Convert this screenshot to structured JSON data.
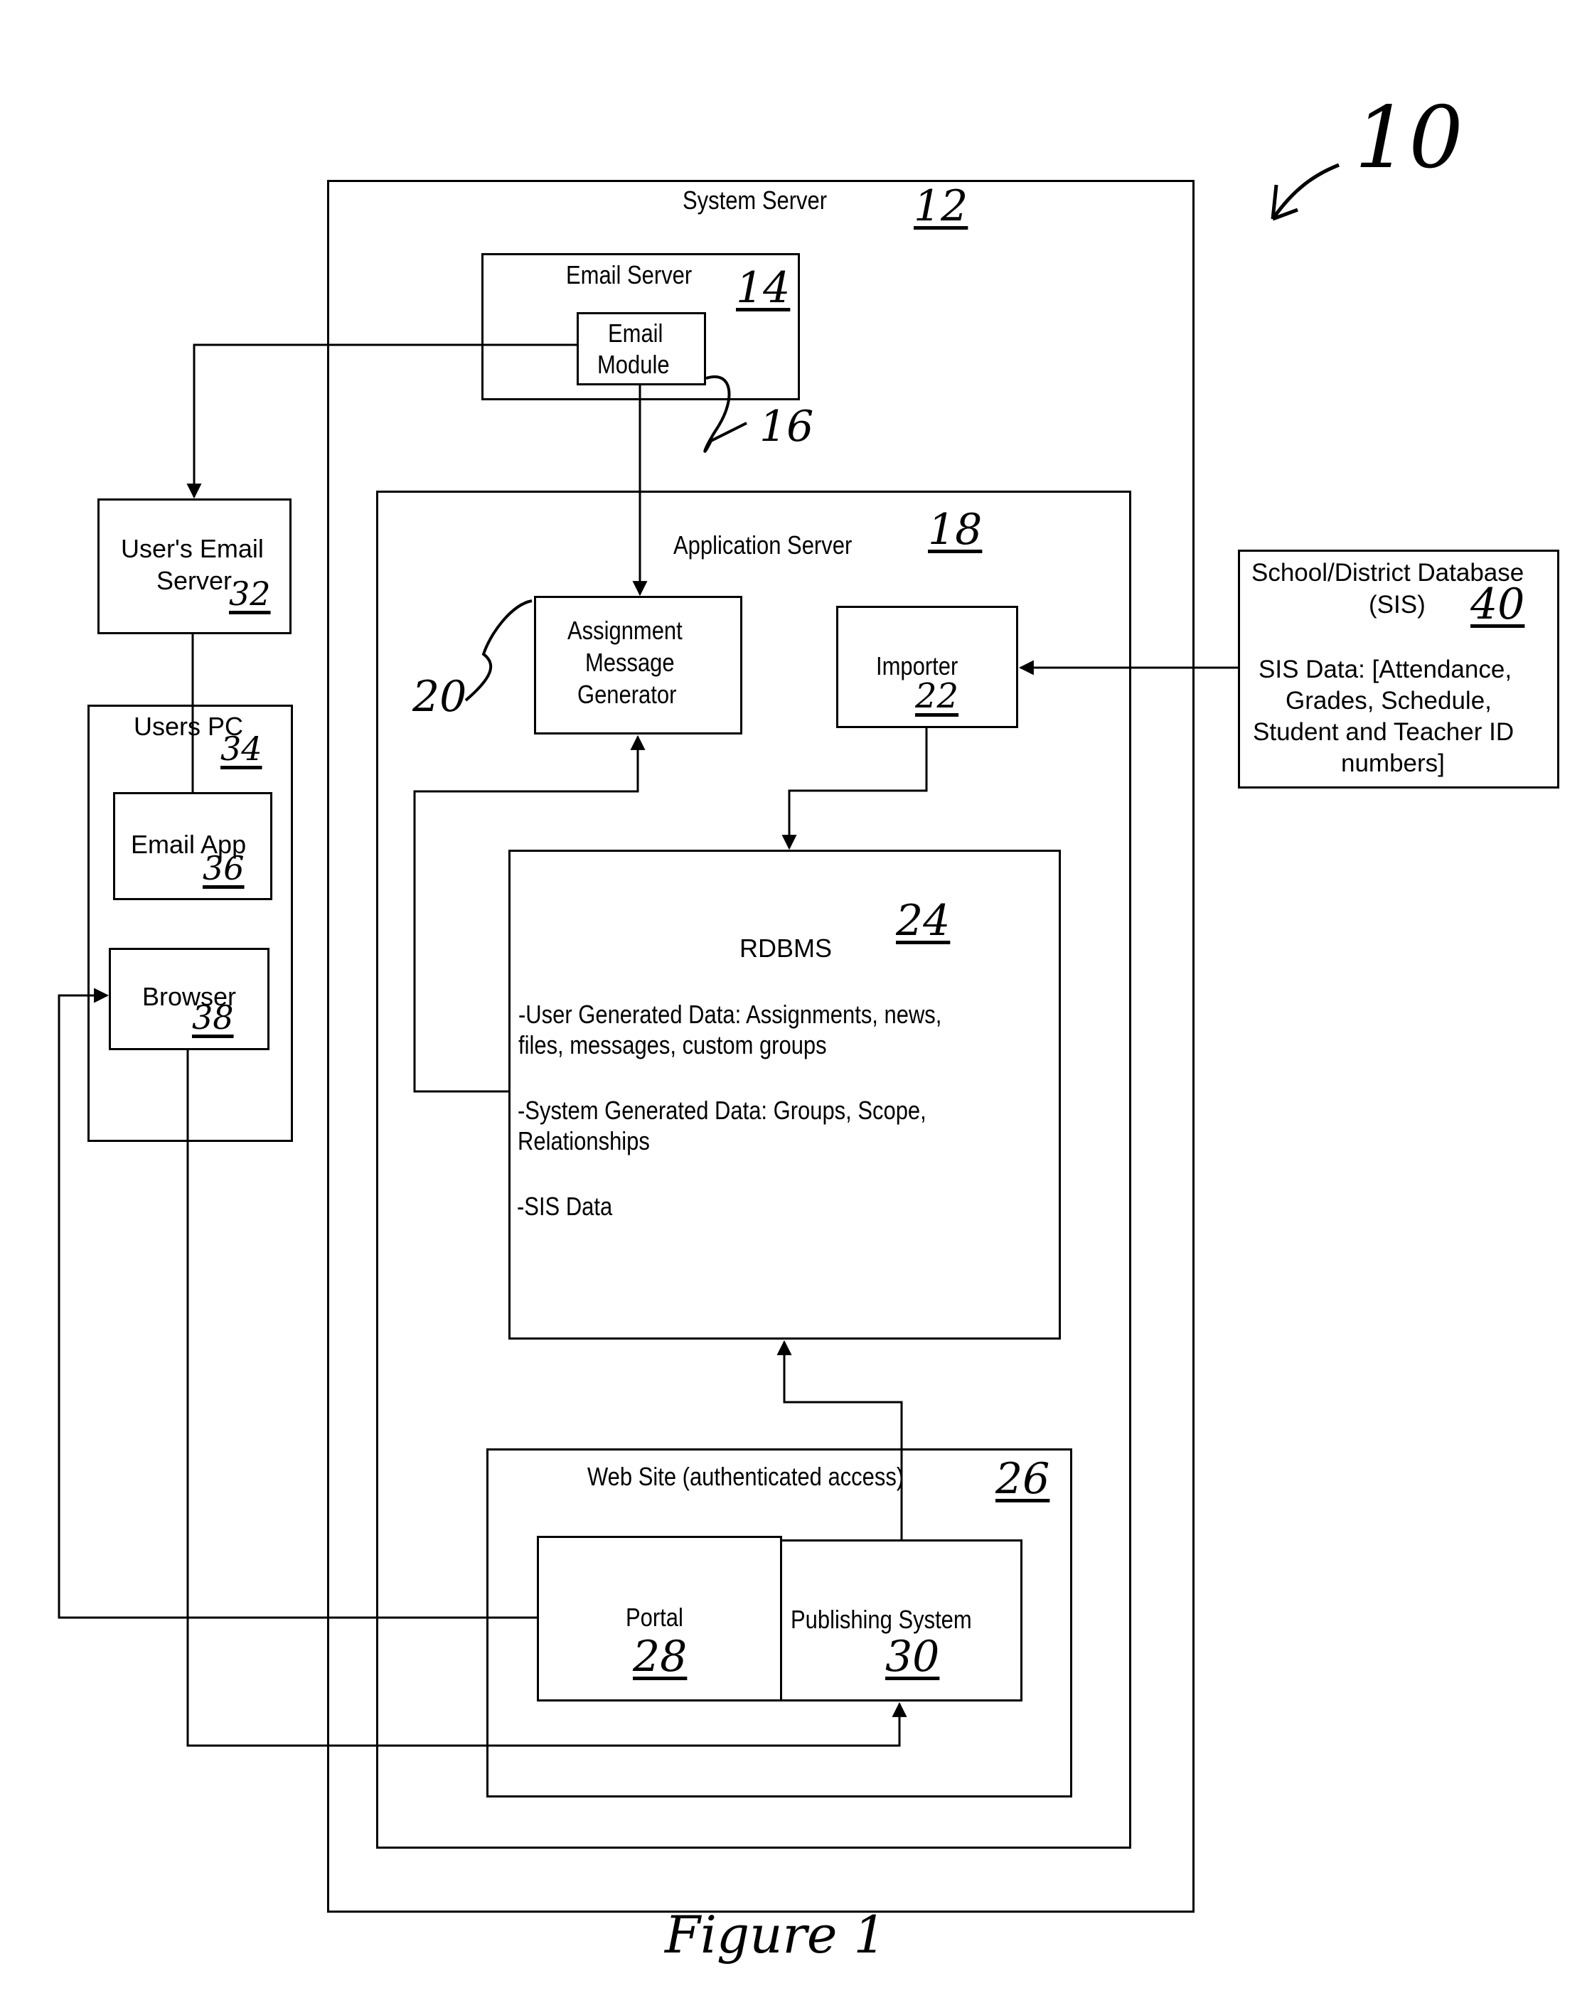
{
  "figure": {
    "title": "Figure 1",
    "reference": "10"
  },
  "nodes": {
    "system_server": {
      "label": "System Server",
      "ref": "12"
    },
    "email_server": {
      "label": "Email Server",
      "ref": "14"
    },
    "email_module": {
      "label_line1": "Email",
      "label_line2": "Module",
      "ref": "16"
    },
    "application_server": {
      "label": "Application Server",
      "ref": "18"
    },
    "assignment_message_generator": {
      "label_line1": "Assignment",
      "label_line2": "Message",
      "label_line3": "Generator",
      "ref": "20"
    },
    "importer": {
      "label": "Importer",
      "ref": "22"
    },
    "rdbms": {
      "label": "RDBMS",
      "ref": "24",
      "items": [
        {
          "line1": "-User Generated Data: Assignments, news,",
          "line2": "files, messages, custom groups"
        },
        {
          "line1": "-System Generated Data: Groups, Scope,",
          "line2": "Relationships"
        },
        {
          "line1": "-SIS Data",
          "line2": ""
        }
      ]
    },
    "web_site": {
      "label": "Web Site (authenticated access)",
      "ref": "26"
    },
    "portal": {
      "label": "Portal",
      "ref": "28"
    },
    "publishing_system": {
      "label": "Publishing System",
      "ref": "30"
    },
    "users_email_server": {
      "label_line1": "User's Email",
      "label_line2": "Server",
      "ref": "32"
    },
    "users_pc": {
      "label": "Users PC",
      "ref": "34"
    },
    "email_app": {
      "label": "Email App",
      "ref": "36"
    },
    "browser": {
      "label": "Browser",
      "ref": "38"
    },
    "school_district_database": {
      "label_line1": "School/District Database",
      "label_line2": "(SIS)",
      "ref": "40",
      "data_line1": "SIS Data: [Attendance,",
      "data_line2": "Grades, Schedule,",
      "data_line3": "Student and Teacher ID",
      "data_line4": "numbers]"
    }
  },
  "edges": [
    {
      "from": "email_module",
      "to": "users_email_server",
      "arrow": "end"
    },
    {
      "from": "email_module",
      "to": "assignment_message_generator",
      "arrow": "end"
    },
    {
      "from": "rdbms",
      "to": "assignment_message_generator",
      "arrow": "end"
    },
    {
      "from": "school_district_database",
      "to": "importer",
      "arrow": "end"
    },
    {
      "from": "importer",
      "to": "rdbms",
      "arrow": "end"
    },
    {
      "from": "publishing_system",
      "to": "rdbms",
      "arrow": "end"
    },
    {
      "from": "users_email_server",
      "to": "email_app",
      "arrow": "none"
    },
    {
      "from": "portal",
      "to": "browser",
      "arrow": "end"
    },
    {
      "from": "browser",
      "to": "publishing_system",
      "arrow": "end"
    }
  ]
}
